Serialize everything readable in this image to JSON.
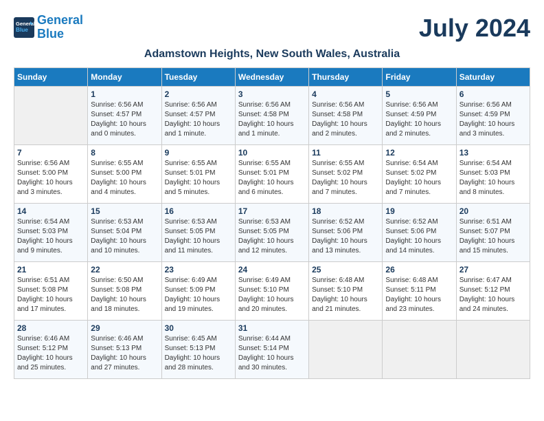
{
  "header": {
    "logo_line1": "General",
    "logo_line2": "Blue",
    "month_year": "July 2024",
    "subtitle": "Adamstown Heights, New South Wales, Australia"
  },
  "days_of_week": [
    "Sunday",
    "Monday",
    "Tuesday",
    "Wednesday",
    "Thursday",
    "Friday",
    "Saturday"
  ],
  "weeks": [
    [
      {
        "day": "",
        "info": ""
      },
      {
        "day": "1",
        "info": "Sunrise: 6:56 AM\nSunset: 4:57 PM\nDaylight: 10 hours\nand 0 minutes."
      },
      {
        "day": "2",
        "info": "Sunrise: 6:56 AM\nSunset: 4:57 PM\nDaylight: 10 hours\nand 1 minute."
      },
      {
        "day": "3",
        "info": "Sunrise: 6:56 AM\nSunset: 4:58 PM\nDaylight: 10 hours\nand 1 minute."
      },
      {
        "day": "4",
        "info": "Sunrise: 6:56 AM\nSunset: 4:58 PM\nDaylight: 10 hours\nand 2 minutes."
      },
      {
        "day": "5",
        "info": "Sunrise: 6:56 AM\nSunset: 4:59 PM\nDaylight: 10 hours\nand 2 minutes."
      },
      {
        "day": "6",
        "info": "Sunrise: 6:56 AM\nSunset: 4:59 PM\nDaylight: 10 hours\nand 3 minutes."
      }
    ],
    [
      {
        "day": "7",
        "info": "Sunrise: 6:56 AM\nSunset: 5:00 PM\nDaylight: 10 hours\nand 3 minutes."
      },
      {
        "day": "8",
        "info": "Sunrise: 6:55 AM\nSunset: 5:00 PM\nDaylight: 10 hours\nand 4 minutes."
      },
      {
        "day": "9",
        "info": "Sunrise: 6:55 AM\nSunset: 5:01 PM\nDaylight: 10 hours\nand 5 minutes."
      },
      {
        "day": "10",
        "info": "Sunrise: 6:55 AM\nSunset: 5:01 PM\nDaylight: 10 hours\nand 6 minutes."
      },
      {
        "day": "11",
        "info": "Sunrise: 6:55 AM\nSunset: 5:02 PM\nDaylight: 10 hours\nand 7 minutes."
      },
      {
        "day": "12",
        "info": "Sunrise: 6:54 AM\nSunset: 5:02 PM\nDaylight: 10 hours\nand 7 minutes."
      },
      {
        "day": "13",
        "info": "Sunrise: 6:54 AM\nSunset: 5:03 PM\nDaylight: 10 hours\nand 8 minutes."
      }
    ],
    [
      {
        "day": "14",
        "info": "Sunrise: 6:54 AM\nSunset: 5:03 PM\nDaylight: 10 hours\nand 9 minutes."
      },
      {
        "day": "15",
        "info": "Sunrise: 6:53 AM\nSunset: 5:04 PM\nDaylight: 10 hours\nand 10 minutes."
      },
      {
        "day": "16",
        "info": "Sunrise: 6:53 AM\nSunset: 5:05 PM\nDaylight: 10 hours\nand 11 minutes."
      },
      {
        "day": "17",
        "info": "Sunrise: 6:53 AM\nSunset: 5:05 PM\nDaylight: 10 hours\nand 12 minutes."
      },
      {
        "day": "18",
        "info": "Sunrise: 6:52 AM\nSunset: 5:06 PM\nDaylight: 10 hours\nand 13 minutes."
      },
      {
        "day": "19",
        "info": "Sunrise: 6:52 AM\nSunset: 5:06 PM\nDaylight: 10 hours\nand 14 minutes."
      },
      {
        "day": "20",
        "info": "Sunrise: 6:51 AM\nSunset: 5:07 PM\nDaylight: 10 hours\nand 15 minutes."
      }
    ],
    [
      {
        "day": "21",
        "info": "Sunrise: 6:51 AM\nSunset: 5:08 PM\nDaylight: 10 hours\nand 17 minutes."
      },
      {
        "day": "22",
        "info": "Sunrise: 6:50 AM\nSunset: 5:08 PM\nDaylight: 10 hours\nand 18 minutes."
      },
      {
        "day": "23",
        "info": "Sunrise: 6:49 AM\nSunset: 5:09 PM\nDaylight: 10 hours\nand 19 minutes."
      },
      {
        "day": "24",
        "info": "Sunrise: 6:49 AM\nSunset: 5:10 PM\nDaylight: 10 hours\nand 20 minutes."
      },
      {
        "day": "25",
        "info": "Sunrise: 6:48 AM\nSunset: 5:10 PM\nDaylight: 10 hours\nand 21 minutes."
      },
      {
        "day": "26",
        "info": "Sunrise: 6:48 AM\nSunset: 5:11 PM\nDaylight: 10 hours\nand 23 minutes."
      },
      {
        "day": "27",
        "info": "Sunrise: 6:47 AM\nSunset: 5:12 PM\nDaylight: 10 hours\nand 24 minutes."
      }
    ],
    [
      {
        "day": "28",
        "info": "Sunrise: 6:46 AM\nSunset: 5:12 PM\nDaylight: 10 hours\nand 25 minutes."
      },
      {
        "day": "29",
        "info": "Sunrise: 6:46 AM\nSunset: 5:13 PM\nDaylight: 10 hours\nand 27 minutes."
      },
      {
        "day": "30",
        "info": "Sunrise: 6:45 AM\nSunset: 5:13 PM\nDaylight: 10 hours\nand 28 minutes."
      },
      {
        "day": "31",
        "info": "Sunrise: 6:44 AM\nSunset: 5:14 PM\nDaylight: 10 hours\nand 30 minutes."
      },
      {
        "day": "",
        "info": ""
      },
      {
        "day": "",
        "info": ""
      },
      {
        "day": "",
        "info": ""
      }
    ]
  ]
}
